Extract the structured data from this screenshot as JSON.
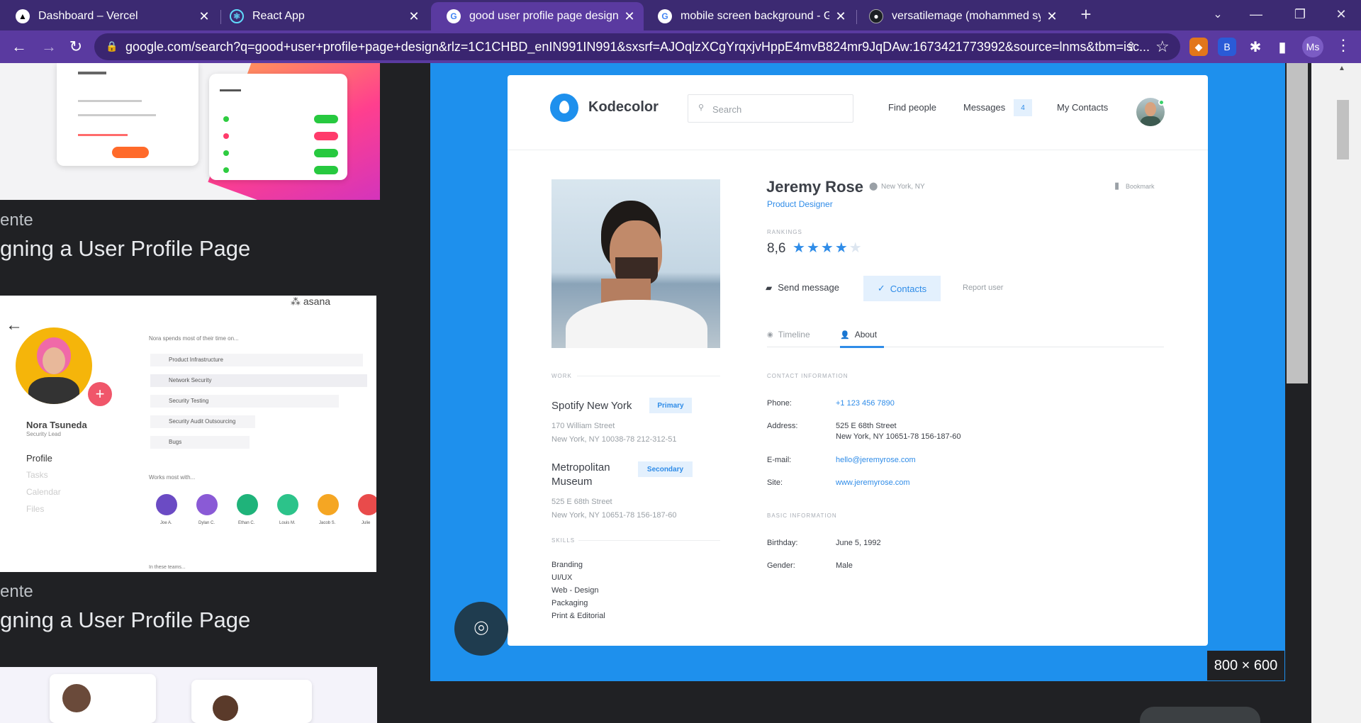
{
  "browser": {
    "tabs": [
      {
        "title": "Dashboard – Vercel",
        "icon": "vercel-icon"
      },
      {
        "title": "React App",
        "icon": "react-icon"
      },
      {
        "title": "good user profile page design - G",
        "icon": "google-icon"
      },
      {
        "title": "mobile screen background - Goo",
        "icon": "google-icon"
      },
      {
        "title": "versatilemage (mohammed syed",
        "icon": "github-icon"
      }
    ],
    "new_tab": "+",
    "url": "google.com/search?q=good+user+profile+page+design&rlz=1C1CHBD_enIN991IN991&sxsrf=AJOqlzXCgYrqxjvHppE4mvB824mr9JqDAw:1673421773992&source=lnms&tbm=isc...",
    "profile_initials": "Ms"
  },
  "results": {
    "items": [
      {
        "source": "ente",
        "title": "gning a User Profile Page"
      },
      {
        "source": "ente",
        "title": "gning a User Profile Page"
      }
    ],
    "thumb2": {
      "brand": "asana",
      "name": "Nora Tsuneda",
      "role": "Security Lead",
      "menu": [
        "Profile",
        "Tasks",
        "Calendar",
        "Files"
      ],
      "heading": "Nora spends most of their time on...",
      "list": [
        "Product Infrastructure",
        "Network Security",
        "Security Testing",
        "Security Audit Outsourcing",
        "Bugs"
      ],
      "works_with": "Works most with...",
      "people": [
        "Joe A.",
        "Dylan C.",
        "Ethan C.",
        "Louis M.",
        "Jacob S.",
        "Julie"
      ],
      "teams": "In these teams..."
    }
  },
  "preview": {
    "size_badge": "800 × 600",
    "card": {
      "brand": "Kodecolor",
      "search_placeholder": "Search",
      "nav": {
        "find": "Find people",
        "messages": "Messages",
        "messages_count": "4",
        "contacts": "My Contacts"
      },
      "name": "Jeremy Rose",
      "location": "New York, NY",
      "role": "Product Designer",
      "bookmark": "Bookmark",
      "rankings_label": "RANKINGS",
      "rating": "8,6",
      "rating_stars": 4,
      "rating_max": 5,
      "actions": {
        "send": "Send message",
        "contacts": "Contacts",
        "report": "Report user"
      },
      "tabs": {
        "timeline": "Timeline",
        "about": "About"
      },
      "work_label": "WORK",
      "work": [
        {
          "name": "Spotify New York",
          "badge": "Primary",
          "line1": "170 William Street",
          "line2": "New York, NY 10038-78 212-312-51"
        },
        {
          "name": "Metropolitan",
          "name2": "Museum",
          "badge": "Secondary",
          "line1": "525 E 68th Street",
          "line2": "New York, NY 10651-78 156-187-60"
        }
      ],
      "skills_label": "SKILLS",
      "skills": [
        "Branding",
        "UI/UX",
        "Web - Design",
        "Packaging",
        "Print & Editorial"
      ],
      "contact_label": "CONTACT INFORMATION",
      "contact": {
        "phone_k": "Phone:",
        "phone_v": "+1 123 456 7890",
        "address_k": "Address:",
        "address_v1": "525 E 68th Street",
        "address_v2": "New York, NY 10651-78 156-187-60",
        "email_k": "E-mail:",
        "email_v": "hello@jeremyrose.com",
        "site_k": "Site:",
        "site_v": "www.jeremyrose.com"
      },
      "basic_label": "BASIC INFORMATION",
      "basic": {
        "birthday_k": "Birthday:",
        "birthday_v": "June 5, 1992",
        "gender_k": "Gender:",
        "gender_v": "Male"
      }
    }
  }
}
